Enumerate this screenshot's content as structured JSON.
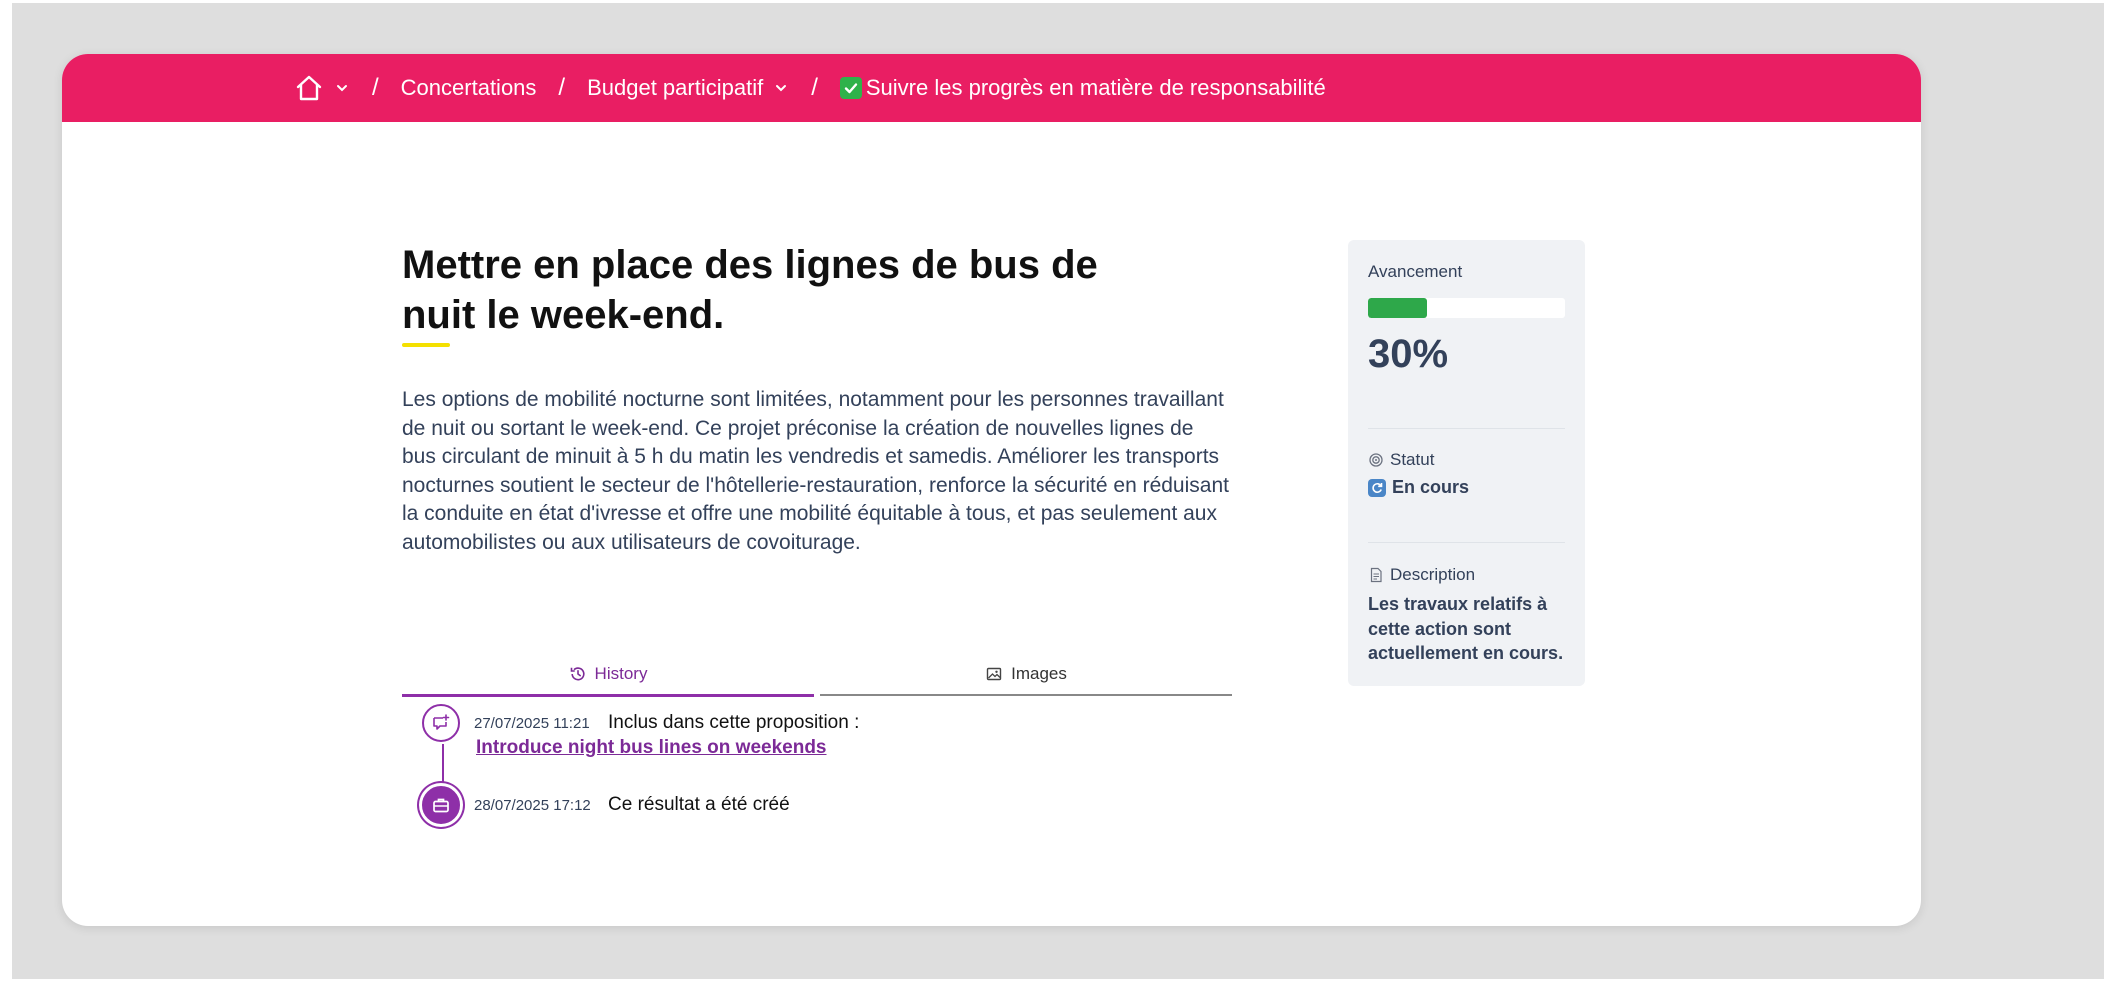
{
  "breadcrumb": {
    "items": [
      {
        "label": "Concertations"
      },
      {
        "label": "Budget participatif"
      },
      {
        "label": "Suivre les progrès en matière de responsabilité"
      }
    ],
    "separator": "/"
  },
  "page": {
    "title": "Mettre en place des lignes de bus de nuit le week-end.",
    "description": "Les options de mobilité nocturne sont limitées, notamment pour les personnes travaillant de nuit ou sortant le week-end. Ce projet préconise la création de nouvelles lignes de bus circulant de minuit à 5 h du matin les vendredis et samedis. Améliorer les transports nocturnes soutient le secteur de l'hôtellerie-restauration, renforce la sécurité en réduisant la conduite en état d'ivresse et offre une mobilité équitable à tous, et pas seulement aux automobilistes ou aux utilisateurs de covoiturage."
  },
  "tabs": [
    {
      "label": "History",
      "icon": "history-icon",
      "active": true
    },
    {
      "label": "Images",
      "icon": "image-icon",
      "active": false
    }
  ],
  "history": [
    {
      "date": "27/07/2025 11:21",
      "text": "Inclus dans cette proposition :",
      "link": "Introduce night bus lines on weekends",
      "icon": "proposal-icon"
    },
    {
      "date": "28/07/2025 17:12",
      "text": "Ce résultat a été créé",
      "icon": "briefcase-icon"
    }
  ],
  "sidebar": {
    "progress_label": "Avancement",
    "progress_value": 0.3,
    "progress_text": "30%",
    "status_label": "Statut",
    "status_value": "En cours",
    "description_label": "Description",
    "description_value": "Les travaux relatifs à cette action sont actuellement en cours."
  },
  "colors": {
    "topbar": "#e91e63",
    "accent": "#8e2fa8",
    "progress": "#2ea84a",
    "title_underline": "#f4e000"
  }
}
